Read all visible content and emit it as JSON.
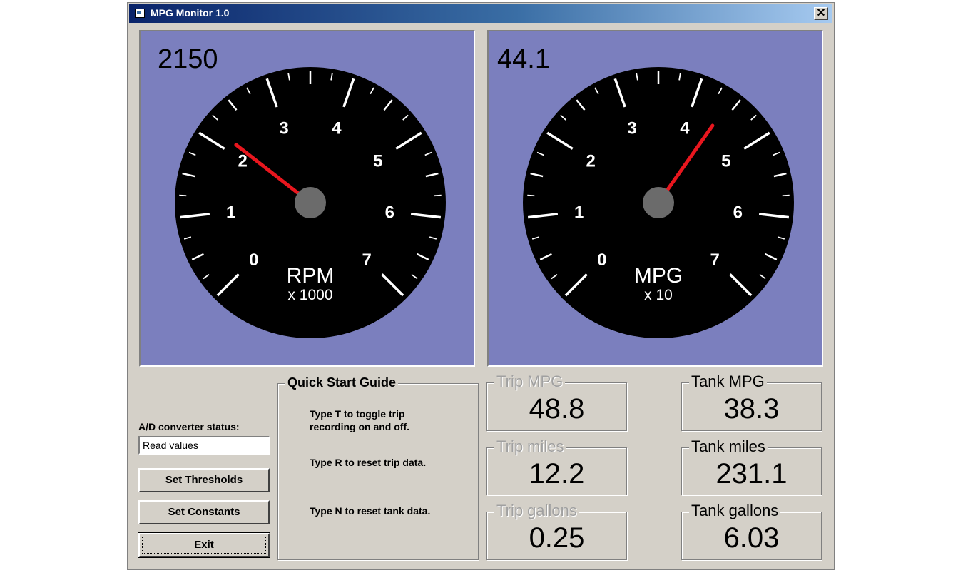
{
  "window": {
    "title": "MPG Monitor 1.0",
    "close_glyph": "✕"
  },
  "gauges": [
    {
      "readout": "2150",
      "label": "RPM",
      "sublabel": "x 1000",
      "ticks": [
        "0",
        "1",
        "2",
        "3",
        "4",
        "5",
        "6",
        "7"
      ],
      "needle_value": 2.15
    },
    {
      "readout": "44.1",
      "label": "MPG",
      "sublabel": "x 10",
      "ticks": [
        "0",
        "1",
        "2",
        "3",
        "4",
        "5",
        "6",
        "7"
      ],
      "needle_value": 4.41
    }
  ],
  "controls": {
    "status_label": "A/D converter status:",
    "status_value": "Read values",
    "set_thresholds": "Set Thresholds",
    "set_constants": "Set Constants",
    "exit": "Exit"
  },
  "guide": {
    "title": "Quick Start Guide",
    "lines": [
      "Type T to toggle trip recording on and off.",
      "Type R to reset trip data.",
      "Type N to reset tank data."
    ]
  },
  "stats": {
    "trip_mpg": {
      "label": "Trip MPG",
      "value": "48.8"
    },
    "trip_miles": {
      "label": "Trip miles",
      "value": "12.2"
    },
    "trip_gallons": {
      "label": "Trip gallons",
      "value": "0.25"
    },
    "tank_mpg": {
      "label": "Tank MPG",
      "value": "38.3"
    },
    "tank_miles": {
      "label": "Tank miles",
      "value": "231.1"
    },
    "tank_gallons": {
      "label": "Tank gallons",
      "value": "6.03"
    }
  },
  "colors": {
    "gauge_bg": "#7b7fbe",
    "dial": "#000000",
    "needle": "#e8161e",
    "hub": "#6b6b6b",
    "titlebar": "#0a246a"
  }
}
